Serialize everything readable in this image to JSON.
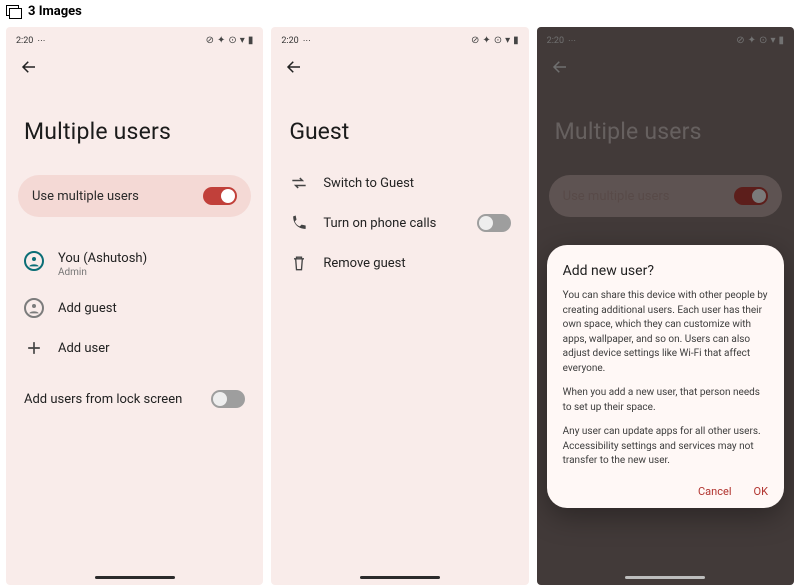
{
  "header": {
    "count_label": "3 Images"
  },
  "status": {
    "time": "2:20",
    "carrier": "  "
  },
  "screen1": {
    "title": "Multiple users",
    "use_multiple_label": "Use multiple users",
    "you_label": "You (Ashutosh)",
    "you_sub": "Admin",
    "add_guest_label": "Add guest",
    "add_user_label": "Add user",
    "lock_label": "Add users from lock screen"
  },
  "screen2": {
    "title": "Guest",
    "switch_label": "Switch to Guest",
    "phone_label": "Turn on phone calls",
    "remove_label": "Remove guest"
  },
  "screen3": {
    "title": "Multiple users",
    "use_multiple_label": "Use multiple users",
    "dialog_title": "Add new user?",
    "p1": "You can share this device with other people by creating additional users. Each user has their own space, which they can customize with apps, wallpaper, and so on. Users can also adjust device settings like Wi-Fi that affect everyone.",
    "p2": "When you add a new user, that person needs to set up their space.",
    "p3": "Any user can update apps for all other users. Accessibility settings and services may not transfer to the new user.",
    "cancel": "Cancel",
    "ok": "OK"
  }
}
